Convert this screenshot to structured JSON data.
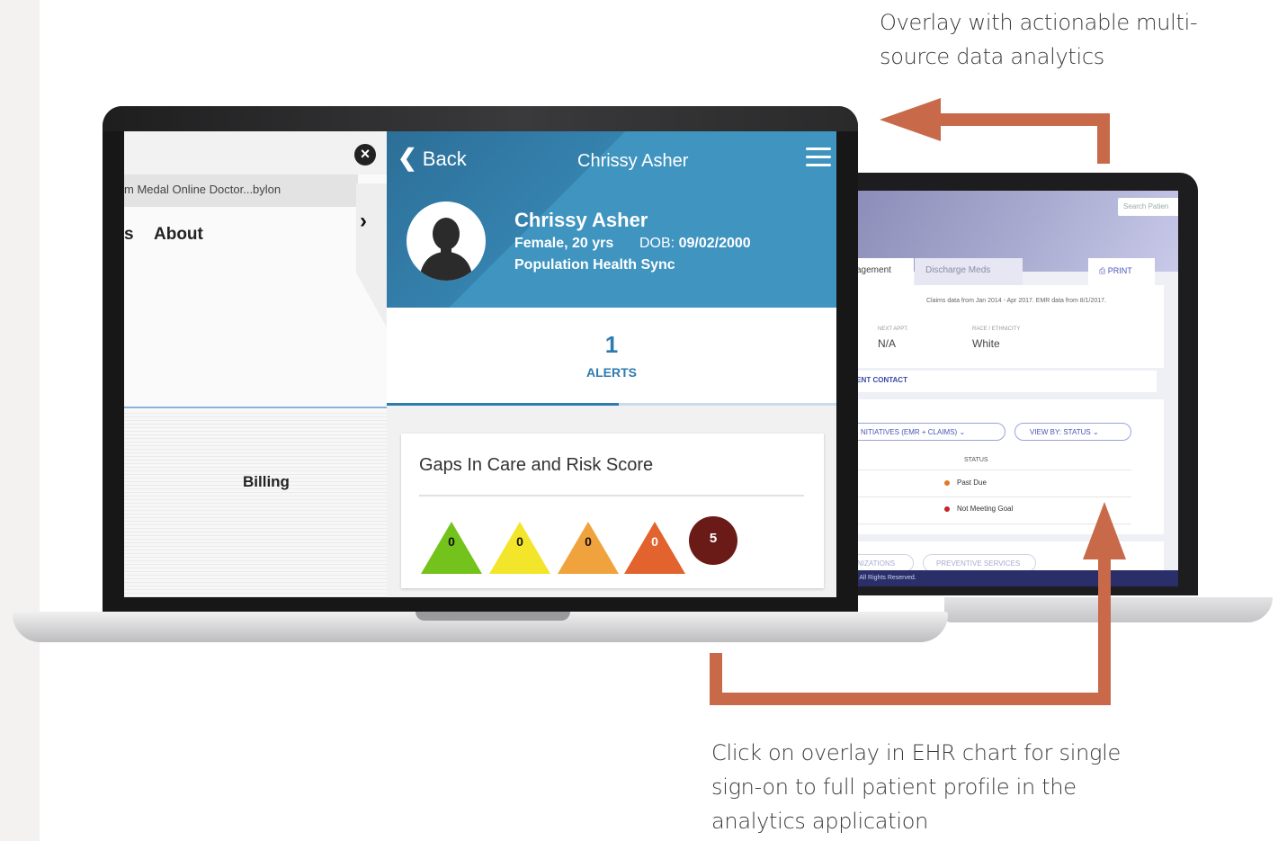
{
  "captions": {
    "top": "Overlay with actionable multi-source data analytics",
    "bottom": "Click on overlay in EHR chart for single sign-on to full patient profile in the analytics application"
  },
  "back_screen": {
    "search_placeholder": "Search Patien",
    "tabs": [
      "agement",
      "Discharge Meds"
    ],
    "print_label": "PRINT",
    "claims_note": "Claims data from Jan 2014 - Apr 2017. EMR data from 8/1/2017.",
    "fields": [
      {
        "label": "NEXT APPT.",
        "value": "N/A"
      },
      {
        "label": "RACE / ETHNICITY",
        "value": "White"
      }
    ],
    "contact_link": "IENT CONTACT",
    "filter_initiatives": "NITIATIVES (EMR + CLAIMS)",
    "filter_view": "VIEW BY: STATUS",
    "status_header": "STATUS",
    "status_rows": [
      {
        "label": "Past Due",
        "color": "#e07a2a"
      },
      {
        "label": "Not Meeting Goal",
        "color": "#c7232c"
      }
    ],
    "lower_pills": [
      "NIZATIONS",
      "PREVENTIVE SERVICES"
    ],
    "footer": "rs. All Rights Reserved."
  },
  "left_pane": {
    "tab_strip": "m    Medal    Online Doctor...bylon",
    "close_glyph": "×",
    "chevron_glyph": "›",
    "stray_letter": "s",
    "about": "About",
    "billing": "Billing"
  },
  "right_pane": {
    "back_label": "Back",
    "header_name": "Chrissy Asher",
    "name": "Chrissy Asher",
    "gender_age": "Female, 20 yrs",
    "dob_label": "DOB:",
    "dob_value": "09/02/2000",
    "sync_label": "Population Health Sync",
    "alerts_count": "1",
    "alerts_label": "ALERTS",
    "card_title": "Gaps In Care and Risk Score",
    "risk_indicators": [
      {
        "value": "0",
        "color": "#74c21c"
      },
      {
        "value": "0",
        "color": "#f2e52a"
      },
      {
        "value": "0",
        "color": "#f0a33c"
      },
      {
        "value": "0",
        "color": "#e2632d"
      }
    ],
    "risk_score": "5"
  },
  "colors": {
    "arrow": "#c8694a",
    "header_blue": "#3f94c0",
    "accent_blue": "#2e7bb0",
    "risk_circle": "#6b1b17"
  }
}
